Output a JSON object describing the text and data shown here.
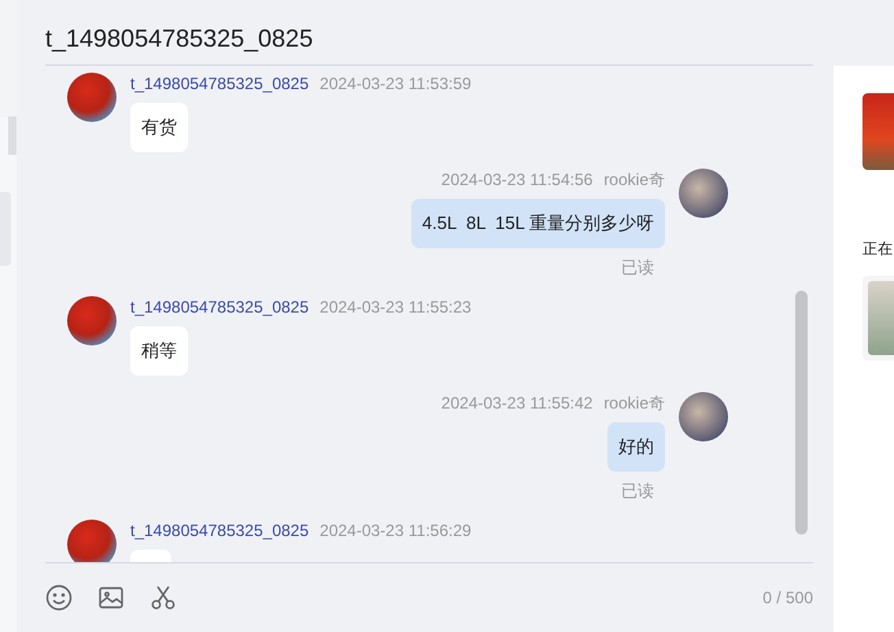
{
  "chat": {
    "title": "t_1498054785325_0825",
    "messages": [
      {
        "kind": "incoming",
        "name": "t_1498054785325_0825",
        "time": "2024-03-23 11:53:59",
        "text": "有货"
      },
      {
        "kind": "outgoing",
        "name": "rookie奇",
        "time": "2024-03-23 11:54:56",
        "text": "4.5L  8L  15L 重量分别多少呀",
        "status": "已读"
      },
      {
        "kind": "incoming",
        "name": "t_1498054785325_0825",
        "time": "2024-03-23 11:55:23",
        "text": "稍等"
      },
      {
        "kind": "outgoing",
        "name": "rookie奇",
        "time": "2024-03-23 11:55:42",
        "text": "好的",
        "status": "已读"
      },
      {
        "kind": "incoming",
        "name": "t_1498054785325_0825",
        "time": "2024-03-23 11:56:29"
      }
    ],
    "counter": "0 / 500"
  },
  "side_panel": {
    "label": "正在"
  }
}
